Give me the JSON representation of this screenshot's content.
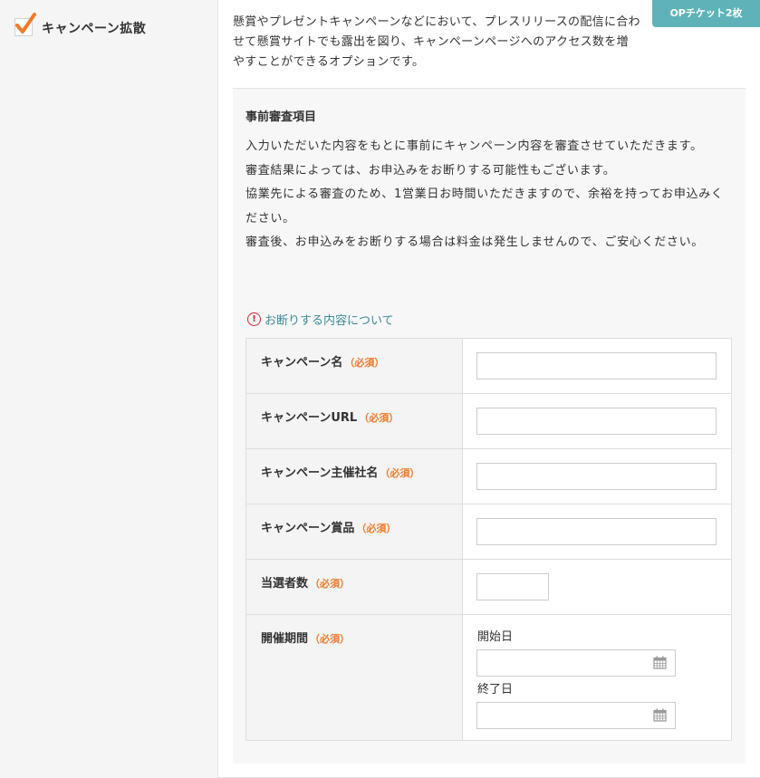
{
  "option": {
    "title": "キャンペーン拡散",
    "checked": true,
    "badge": "OPチケット2枚",
    "description": "懸賞やプレゼントキャンペーンなどにおいて、プレスリリースの配信に合わせて懸賞サイトでも露出を図り、キャンペーンページへのアクセス数を増やすことができるオプションです。"
  },
  "review": {
    "title": "事前審査項目",
    "paragraphs": [
      "入力いただいた内容をもとに事前にキャンペーン内容を審査させていただきます。",
      "審査結果によっては、お申込みをお断りする可能性もございます。",
      "協業先による審査のため、1営業日お時間いただきますので、余裕を持ってお申込みください。",
      "審査後、お申込みをお断りする場合は料金は発生しませんので、ご安心ください。"
    ],
    "refusal_link": "お断りする内容について"
  },
  "form": {
    "required_tag": "（必須）",
    "fields": [
      {
        "label": "キャンペーン名",
        "value": ""
      },
      {
        "label": "キャンペーンURL",
        "value": ""
      },
      {
        "label": "キャンペーン主催社名",
        "value": ""
      },
      {
        "label": "キャンペーン賞品",
        "value": ""
      },
      {
        "label": "当選者数",
        "value": ""
      },
      {
        "label": "開催期間"
      }
    ],
    "period": {
      "start_label": "開始日",
      "start_value": "",
      "end_label": "終了日",
      "end_value": ""
    }
  },
  "colors": {
    "accent_orange": "#f07a2a",
    "badge_teal": "#5fb3b8",
    "link": "#3e8a9a",
    "warning_red": "#d0262a"
  }
}
